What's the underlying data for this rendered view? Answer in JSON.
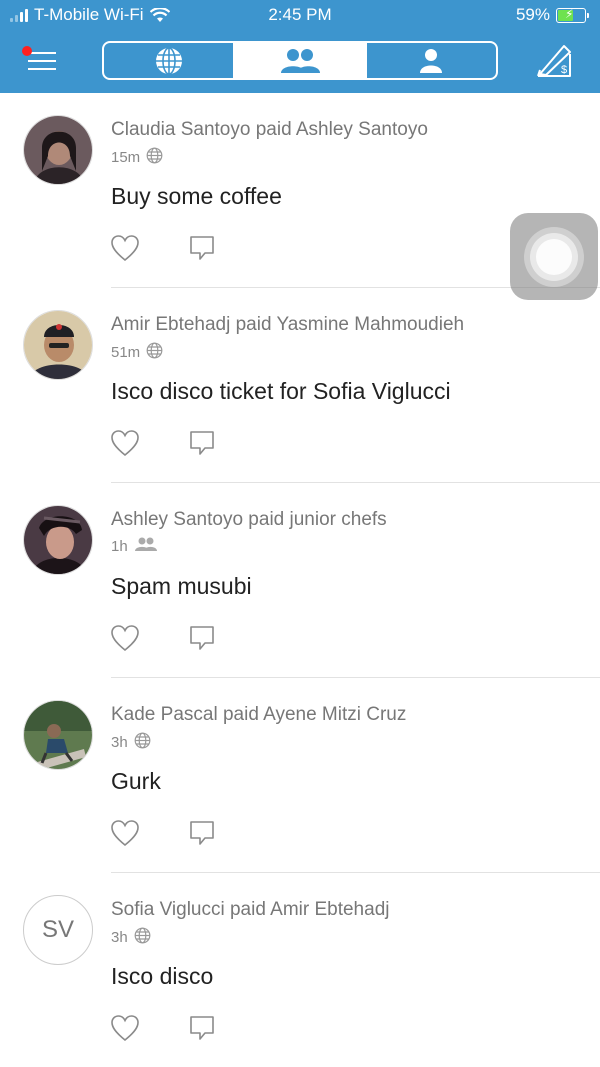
{
  "status_bar": {
    "carrier": "T-Mobile Wi-Fi",
    "time": "2:45 PM",
    "battery": "59%"
  },
  "header": {
    "menu_icon": "hamburger-menu-icon",
    "tabs": [
      {
        "icon": "globe-icon",
        "active": false
      },
      {
        "icon": "friends-icon",
        "active": true
      },
      {
        "icon": "person-icon",
        "active": false
      }
    ],
    "pay_icon": "pay-request-icon",
    "accent": "#3d95ce",
    "notification_dot_color": "#ff2020"
  },
  "feed": [
    {
      "headline": "Claudia Santoyo paid Ashley Santoyo",
      "time": "15m",
      "privacy_icon": "globe-icon",
      "note": "Buy some coffee",
      "avatar": "photo"
    },
    {
      "headline": "Amir Ebtehadj paid Yasmine Mahmoudieh",
      "time": "51m",
      "privacy_icon": "globe-icon",
      "note": "Isco disco ticket for Sofia Viglucci",
      "avatar": "photo"
    },
    {
      "headline": "Ashley Santoyo paid junior chefs",
      "time": "1h",
      "privacy_icon": "friends-icon",
      "note": "Spam musubi",
      "avatar": "photo"
    },
    {
      "headline": "Kade Pascal paid Ayene Mitzi Cruz",
      "time": "3h",
      "privacy_icon": "globe-icon",
      "note": "Gurk",
      "avatar": "photo"
    },
    {
      "headline": "Sofia Viglucci paid Amir Ebtehadj",
      "time": "3h",
      "privacy_icon": "globe-icon",
      "note": "Isco disco",
      "avatar_initials": "SV"
    }
  ]
}
